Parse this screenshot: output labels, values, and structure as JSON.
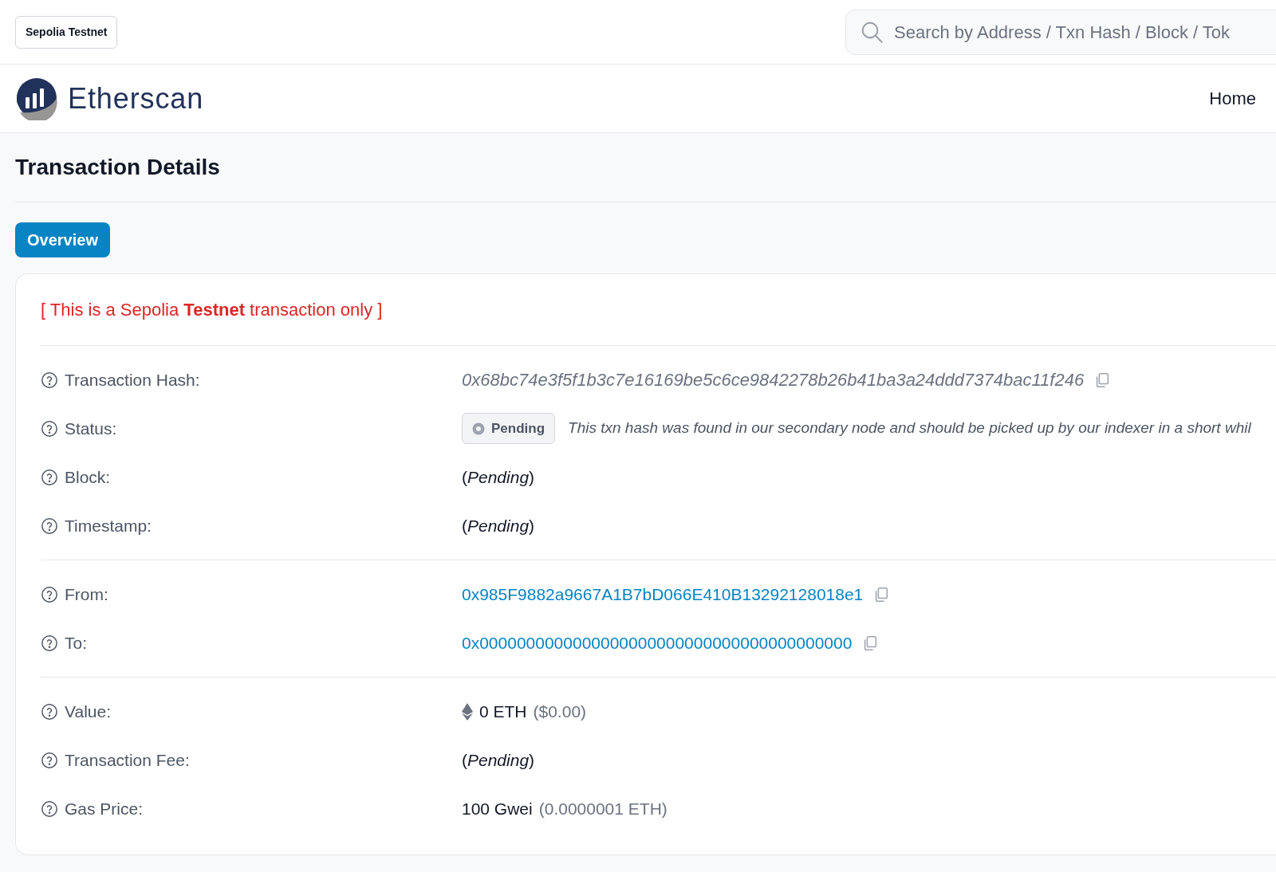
{
  "network_badge": "Sepolia Testnet",
  "search": {
    "placeholder": "Search by Address / Txn Hash / Block / Tok"
  },
  "brand": {
    "name": "Etherscan"
  },
  "nav": {
    "items": [
      {
        "label": "Home"
      }
    ]
  },
  "page_title": "Transaction Details",
  "tabs": [
    {
      "label": "Overview",
      "selected": true
    }
  ],
  "notice": "[ This is a Sepolia **Testnet** transaction only ]",
  "sections": [
    [
      {
        "label": "Transaction Hash:",
        "kind": "hash",
        "value": "0x68bc74e3f5f1b3c7e16169be5c6ce9842278b26b41ba3a24ddd7374bac11f246"
      },
      {
        "label": "Status:",
        "kind": "status",
        "badge": "Pending",
        "note": "This txn hash was found in our secondary node and should be picked up by our indexer in a short whil"
      },
      {
        "label": "Block:",
        "kind": "pending",
        "value": "(*Pending*)"
      },
      {
        "label": "Timestamp:",
        "kind": "pending",
        "value": "(*Pending*)"
      }
    ],
    [
      {
        "label": "From:",
        "kind": "address",
        "value": "0x985F9882a9667A1B7bD066E410B13292128018e1"
      },
      {
        "label": "To:",
        "kind": "address",
        "value": "0x0000000000000000000000000000000000000000"
      }
    ],
    [
      {
        "label": "Value:",
        "kind": "eth_amount",
        "amount": "0 ETH",
        "fiat": "($0.00)"
      },
      {
        "label": "Transaction Fee:",
        "kind": "pending",
        "value": "(*Pending*)"
      },
      {
        "label": "Gas Price:",
        "kind": "amount",
        "amount": "100 Gwei",
        "fiat": "(0.0000001 ETH)"
      }
    ]
  ]
}
